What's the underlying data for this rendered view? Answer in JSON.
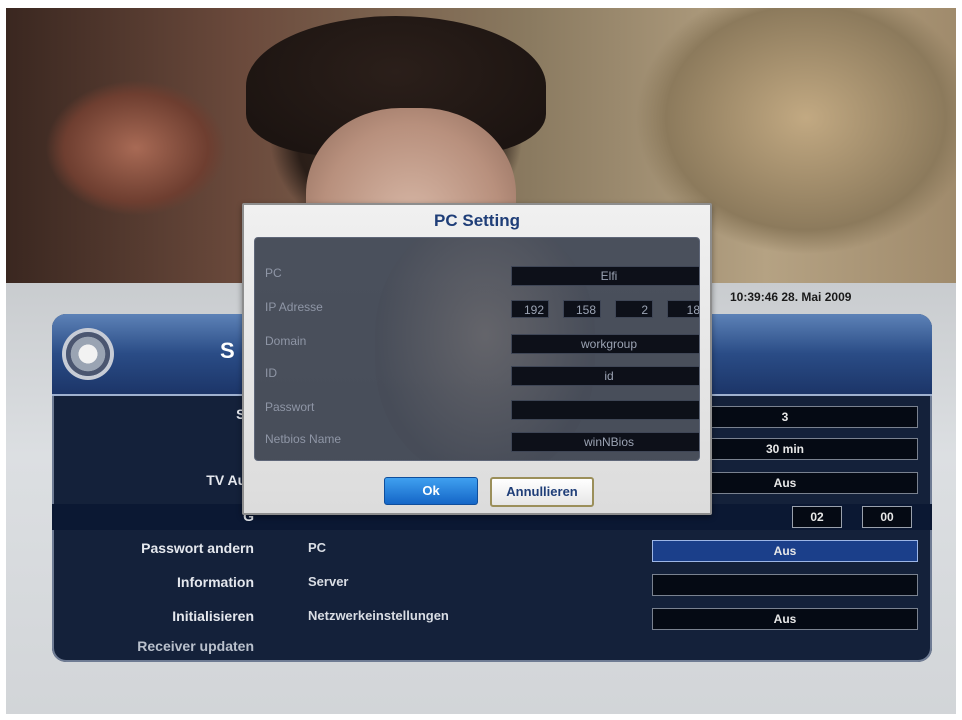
{
  "datetime": "10:39:46  28. Mai 2009",
  "panel": {
    "title": "S",
    "rows": [
      {
        "label": "Sp",
        "value": "3"
      },
      {
        "label": "",
        "value": "30 min"
      },
      {
        "label": "TV Aus",
        "value": "Aus"
      },
      {
        "label": "G",
        "time_h": "02",
        "time_m": "00"
      },
      {
        "label": "Passwort andern",
        "sub": "PC",
        "value": "Aus"
      },
      {
        "label": "Information",
        "sub": "Server",
        "value": ""
      },
      {
        "label": "Initialisieren",
        "sub": "Netzwerkeinstellungen",
        "value": "Aus"
      },
      {
        "label": "Receiver updaten",
        "sub": "",
        "value": ""
      }
    ]
  },
  "dialog": {
    "title": "PC Setting",
    "fields": [
      {
        "label": "PC",
        "value": "Elfi"
      },
      {
        "label": "IP Adresse",
        "ip": [
          "192",
          "158",
          "2",
          "18"
        ]
      },
      {
        "label": "Domain",
        "value": "workgroup"
      },
      {
        "label": "ID",
        "value": "id"
      },
      {
        "label": "Passwort",
        "value": ""
      },
      {
        "label": "Netbios Name",
        "value": "winNBios"
      }
    ],
    "ok_label": "Ok",
    "cancel_label": "Annullieren"
  }
}
